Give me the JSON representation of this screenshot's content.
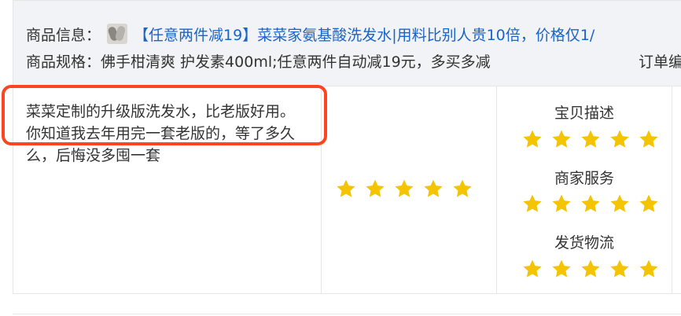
{
  "product": {
    "info_label": "商品信息：",
    "title": "【任意两件减19】菜菜家氨基酸洗发水|用料比别人贵10倍，价格仅1/",
    "spec_label": "商品规格：",
    "spec_value": "佛手柑清爽 护发素400ml;任意两件自动减19元，多买多减",
    "order_label": "订单编"
  },
  "review": {
    "text": " 菜菜定制的升级版洗发水，比老版好用。你知道我去年用完一套老版的，等了多久么，后悔没多囤一套",
    "rating_stars": 5
  },
  "shop_ratings": [
    {
      "label": "宝贝描述",
      "stars": 5
    },
    {
      "label": "商家服务",
      "stars": 5
    },
    {
      "label": "发货物流",
      "stars": 5
    }
  ],
  "colors": {
    "accent_link": "#1b64c7",
    "star": "#f5c400",
    "highlight": "#ff4422",
    "header_bg": "#f1f3f6"
  },
  "icons": {
    "star": "star-icon",
    "thumbnail": "product-thumbnail"
  }
}
